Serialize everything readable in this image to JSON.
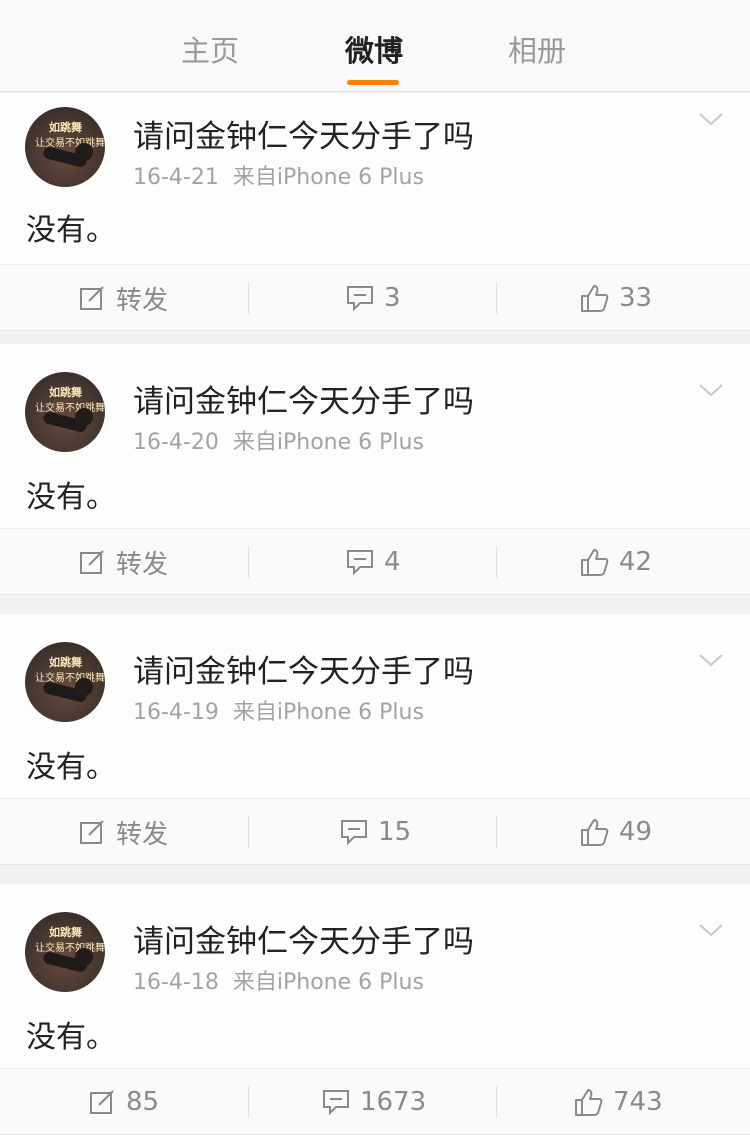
{
  "tabs": [
    {
      "label": "主页",
      "active": false
    },
    {
      "label": "微博",
      "active": true
    },
    {
      "label": "相册",
      "active": false
    }
  ],
  "accent_color": "#ff8200",
  "avatar": {
    "caption_top": "如跳舞",
    "caption_bottom": "让交易不如跳舞"
  },
  "posts": [
    {
      "username": "请问金钟仁今天分手了吗",
      "date": "16-4-21",
      "source": "来自iPhone 6 Plus",
      "content": "没有。",
      "repost": "转发",
      "comments": "3",
      "likes": "33"
    },
    {
      "username": "请问金钟仁今天分手了吗",
      "date": "16-4-20",
      "source": "来自iPhone 6 Plus",
      "content": "没有。",
      "repost": "转发",
      "comments": "4",
      "likes": "42"
    },
    {
      "username": "请问金钟仁今天分手了吗",
      "date": "16-4-19",
      "source": "来自iPhone 6 Plus",
      "content": "没有。",
      "repost": "转发",
      "comments": "15",
      "likes": "49"
    },
    {
      "username": "请问金钟仁今天分手了吗",
      "date": "16-4-18",
      "source": "来自iPhone 6 Plus",
      "content": "没有。",
      "repost": "85",
      "comments": "1673",
      "likes": "743"
    }
  ],
  "icons": {
    "repost": "repost-icon",
    "comment": "comment-icon",
    "like": "like-icon",
    "more": "chevron-down-icon"
  }
}
